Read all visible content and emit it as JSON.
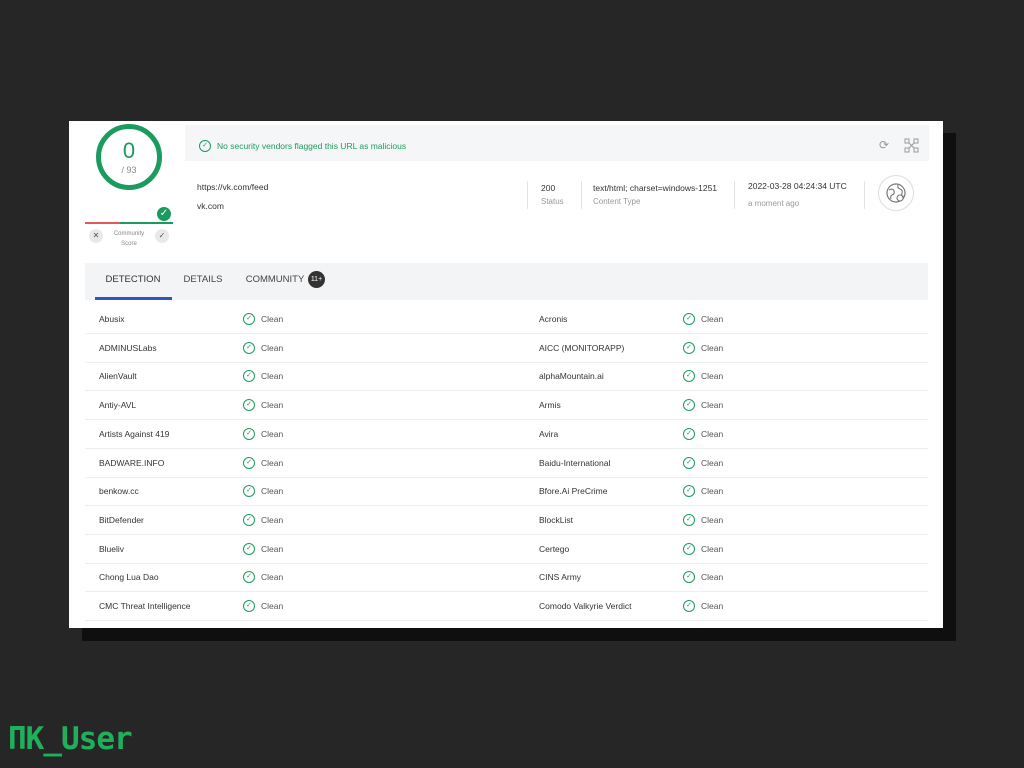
{
  "score": {
    "value": "0",
    "total": "/ 93",
    "community_label": "Community Score"
  },
  "banner": {
    "message": "No security vendors flagged this URL as malicious"
  },
  "info": {
    "url": "https://vk.com/feed",
    "domain": "vk.com",
    "status_value": "200",
    "status_label": "Status",
    "content_type_value": "text/html; charset=windows-1251",
    "content_type_label": "Content Type",
    "date_value": "2022-03-28 04:24:34 UTC",
    "date_label": "a moment ago"
  },
  "tabs": {
    "detection": "DETECTION",
    "details": "DETAILS",
    "community": "COMMUNITY",
    "community_badge": "11+"
  },
  "rows": [
    {
      "left": {
        "vendor": "Abusix",
        "status": "Clean"
      },
      "right": {
        "vendor": "Acronis",
        "status": "Clean"
      }
    },
    {
      "left": {
        "vendor": "ADMINUSLabs",
        "status": "Clean"
      },
      "right": {
        "vendor": "AICC (MONITORAPP)",
        "status": "Clean"
      }
    },
    {
      "left": {
        "vendor": "AlienVault",
        "status": "Clean"
      },
      "right": {
        "vendor": "alphaMountain.ai",
        "status": "Clean"
      }
    },
    {
      "left": {
        "vendor": "Antiy-AVL",
        "status": "Clean"
      },
      "right": {
        "vendor": "Armis",
        "status": "Clean"
      }
    },
    {
      "left": {
        "vendor": "Artists Against 419",
        "status": "Clean"
      },
      "right": {
        "vendor": "Avira",
        "status": "Clean"
      }
    },
    {
      "left": {
        "vendor": "BADWARE.INFO",
        "status": "Clean"
      },
      "right": {
        "vendor": "Baidu-International",
        "status": "Clean"
      }
    },
    {
      "left": {
        "vendor": "benkow.cc",
        "status": "Clean"
      },
      "right": {
        "vendor": "Bfore.Ai PreCrime",
        "status": "Clean"
      }
    },
    {
      "left": {
        "vendor": "BitDefender",
        "status": "Clean"
      },
      "right": {
        "vendor": "BlockList",
        "status": "Clean"
      }
    },
    {
      "left": {
        "vendor": "Blueliv",
        "status": "Clean"
      },
      "right": {
        "vendor": "Certego",
        "status": "Clean"
      }
    },
    {
      "left": {
        "vendor": "Chong Lua Dao",
        "status": "Clean"
      },
      "right": {
        "vendor": "CINS Army",
        "status": "Clean"
      }
    },
    {
      "left": {
        "vendor": "CMC Threat Intelligence",
        "status": "Clean"
      },
      "right": {
        "vendor": "Comodo Valkyrie Verdict",
        "status": "Clean"
      }
    }
  ],
  "watermark": "ПК_User",
  "colors": {
    "accent_green": "#1c9b5f",
    "tab_underline": "#2d55c6",
    "danger_red": "#e05a5a"
  },
  "icons": {
    "refresh": "refresh-icon",
    "graph": "graph-icon",
    "globe": "globe-icon",
    "check": "check-circle-icon"
  }
}
